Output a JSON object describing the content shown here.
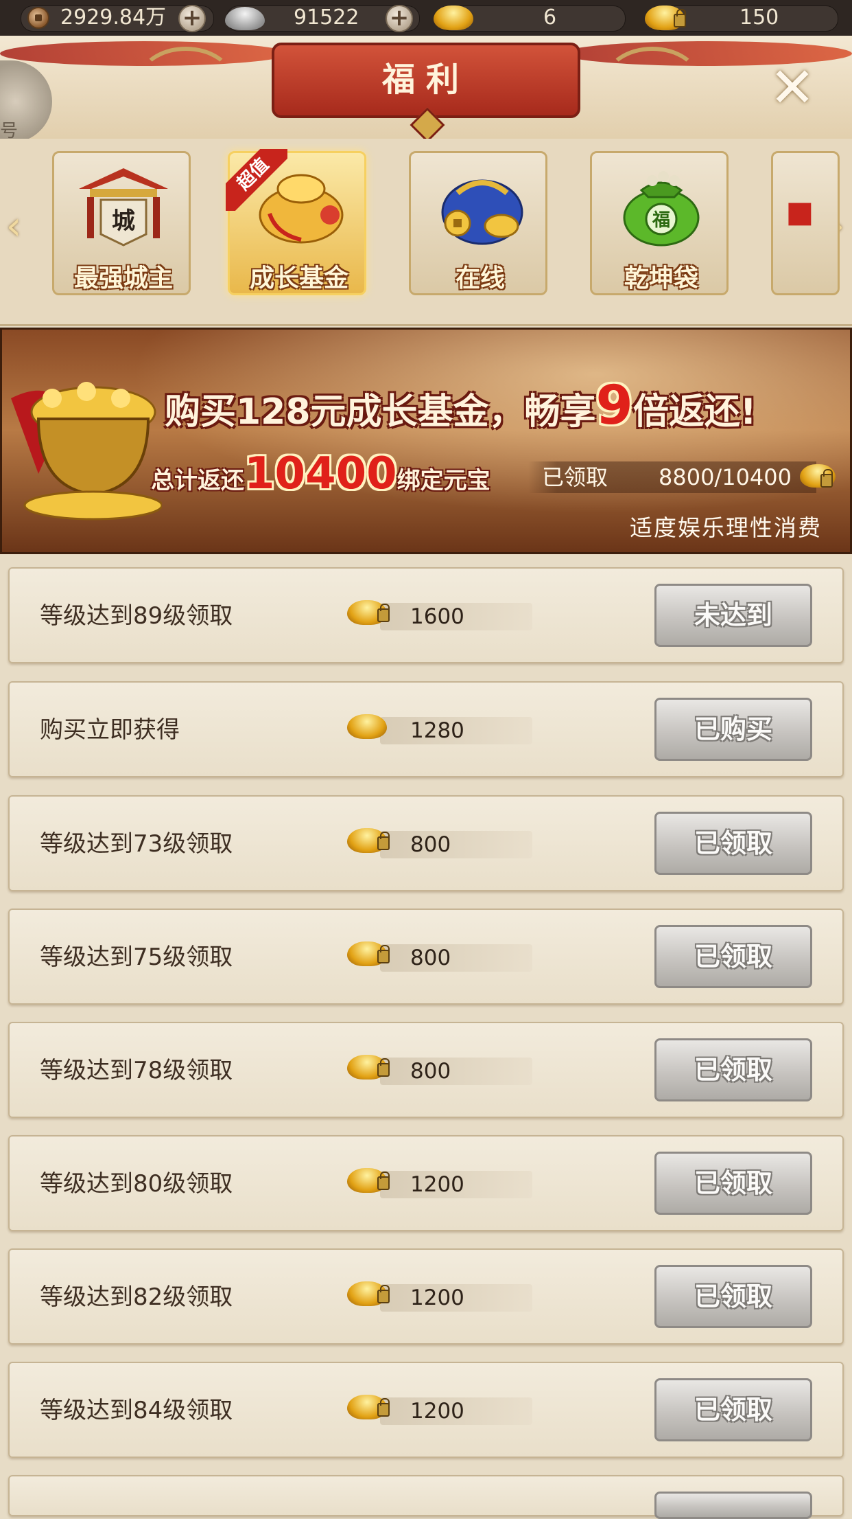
{
  "currency": {
    "copper": "2929.84万",
    "silver": "91522",
    "gold": "6",
    "bound_gold": "150"
  },
  "header": {
    "title": "福利",
    "back_label": "号"
  },
  "tabs": [
    {
      "label": "最强城主",
      "art_char": "城"
    },
    {
      "label": "成长基金",
      "badge": "超值",
      "active": true
    },
    {
      "label": "在线"
    },
    {
      "label": "乾坤袋",
      "art_char": "福"
    },
    {
      "label": ""
    }
  ],
  "banner": {
    "line1_prefix": "购买128元成长基金，畅享",
    "multiplier": "9",
    "line1_suffix": "倍返还!",
    "line2_prefix": "总计返还",
    "total": "10400",
    "line2_suffix": "绑定元宝",
    "claimed_label": "已领取",
    "claimed_value": "8800/10400",
    "notice": "适度娱乐理性消费"
  },
  "rewards": [
    {
      "label": "等级达到89级领取",
      "amount": "1600",
      "locked": true,
      "status": "未达到"
    },
    {
      "label": "购买立即获得",
      "amount": "1280",
      "locked": false,
      "status": "已购买"
    },
    {
      "label": "等级达到73级领取",
      "amount": "800",
      "locked": true,
      "status": "已领取"
    },
    {
      "label": "等级达到75级领取",
      "amount": "800",
      "locked": true,
      "status": "已领取"
    },
    {
      "label": "等级达到78级领取",
      "amount": "800",
      "locked": true,
      "status": "已领取"
    },
    {
      "label": "等级达到80级领取",
      "amount": "1200",
      "locked": true,
      "status": "已领取"
    },
    {
      "label": "等级达到82级领取",
      "amount": "1200",
      "locked": true,
      "status": "已领取"
    },
    {
      "label": "等级达到84级领取",
      "amount": "1200",
      "locked": true,
      "status": "已领取"
    }
  ],
  "colors": {
    "accent_red": "#c8241c",
    "banner_highlight": "#e0211a",
    "button_gray": "#c7c4c0"
  }
}
